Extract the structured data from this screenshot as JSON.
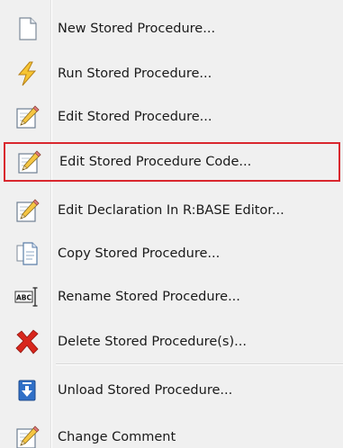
{
  "menu": {
    "items": [
      {
        "label": "New Stored Procedure...",
        "icon": "new-document-icon"
      },
      {
        "label": "Run Stored Procedure...",
        "icon": "lightning-icon"
      },
      {
        "label": "Edit Stored Procedure...",
        "icon": "edit-pencil-icon"
      },
      {
        "label": "Edit Stored Procedure Code...",
        "icon": "edit-pencil-icon"
      },
      {
        "label": "Edit Declaration In R:BASE Editor...",
        "icon": "edit-pencil-icon"
      },
      {
        "label": "Copy Stored Procedure...",
        "icon": "copy-icon"
      },
      {
        "label": "Rename Stored Procedure...",
        "icon": "rename-abc-icon"
      },
      {
        "label": "Delete Stored Procedure(s)...",
        "icon": "delete-x-icon"
      },
      {
        "label": "Unload Stored Procedure...",
        "icon": "unload-arrow-icon"
      },
      {
        "label": "Change Comment",
        "icon": "edit-pencil-icon"
      }
    ]
  },
  "colors": {
    "highlight_border": "#d9272e",
    "menu_background": "#f0f0f0",
    "lightning": "#f2b61b",
    "delete_x": "#d8261c",
    "unload_blue": "#2f6fc7"
  }
}
